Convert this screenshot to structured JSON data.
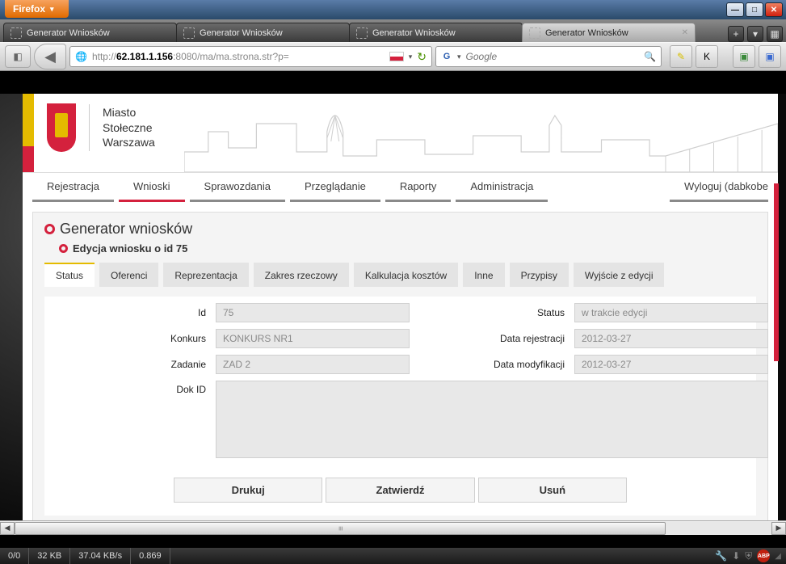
{
  "browser": {
    "menu_button": "Firefox",
    "tabs": [
      {
        "title": "Generator Wniosków",
        "active": false
      },
      {
        "title": "Generator Wniosków",
        "active": false
      },
      {
        "title": "Generator Wniosków",
        "active": false
      },
      {
        "title": "Generator Wniosków",
        "active": true
      }
    ],
    "url_prefix": "http://",
    "url_host": "62.181.1.156",
    "url_path": ":8080/ma/ma.strona.str?p=",
    "search_placeholder": "Google"
  },
  "site": {
    "logo_lines": [
      "Miasto",
      "Stołeczne",
      "Warszawa"
    ],
    "nav": [
      {
        "label": "Rejestracja",
        "active": false
      },
      {
        "label": "Wnioski",
        "active": true
      },
      {
        "label": "Sprawozdania",
        "active": false
      },
      {
        "label": "Przeglądanie",
        "active": false
      },
      {
        "label": "Raporty",
        "active": false
      },
      {
        "label": "Administracja",
        "active": false
      }
    ],
    "logout": "Wyloguj (dabkobe"
  },
  "panel": {
    "title": "Generator wniosków",
    "subtitle": "Edycja wniosku o id 75",
    "tabs": [
      {
        "label": "Status",
        "active": true
      },
      {
        "label": "Oferenci",
        "active": false
      },
      {
        "label": "Reprezentacja",
        "active": false
      },
      {
        "label": "Zakres rzeczowy",
        "active": false
      },
      {
        "label": "Kalkulacja kosztów",
        "active": false
      },
      {
        "label": "Inne",
        "active": false
      },
      {
        "label": "Przypisy",
        "active": false
      },
      {
        "label": "Wyjście z edycji",
        "active": false
      }
    ],
    "form": {
      "id_label": "Id",
      "id_value": "75",
      "status_label": "Status",
      "status_value": "w trakcie edycji",
      "konkurs_label": "Konkurs",
      "konkurs_value": "KONKURS NR1",
      "data_rej_label": "Data rejestracji",
      "data_rej_value": "2012-03-27",
      "zadanie_label": "Zadanie",
      "zadanie_value": "ZAD 2",
      "data_mod_label": "Data modyfikacji",
      "data_mod_value": "2012-03-27",
      "dokid_label": "Dok ID"
    },
    "actions": {
      "print": "Drukuj",
      "approve": "Zatwierdź",
      "delete": "Usuń"
    }
  },
  "status": {
    "s1": "0/0",
    "s2": "32 KB",
    "s3": "37.04 KB/s",
    "s4": "0.869"
  }
}
